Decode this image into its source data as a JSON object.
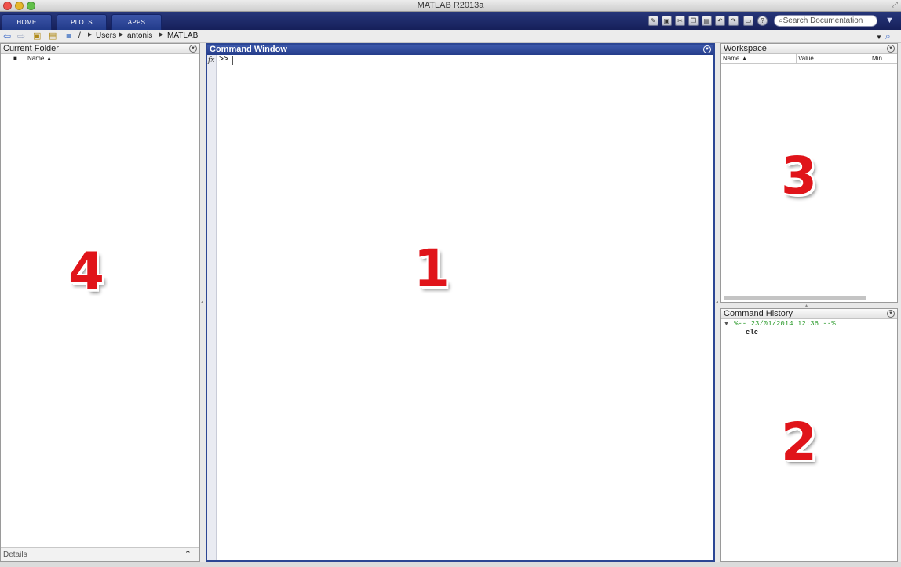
{
  "window": {
    "title": "MATLAB R2013a"
  },
  "tabs": [
    {
      "label": "HOME"
    },
    {
      "label": "PLOTS"
    },
    {
      "label": "APPS"
    }
  ],
  "toolbar": {
    "search_placeholder": "Search Documentation"
  },
  "address": {
    "root": "/",
    "crumbs": [
      "Users",
      "antonis",
      "MATLAB"
    ]
  },
  "current_folder": {
    "title": "Current Folder",
    "column_name": "Name ▲",
    "details_label": "Details",
    "annotation": "4"
  },
  "command_window": {
    "title": "Command Window",
    "prompt": ">>",
    "fx_label": "fx",
    "annotation": "1"
  },
  "workspace": {
    "title": "Workspace",
    "columns": [
      "Name ▲",
      "Value",
      "Min"
    ],
    "annotation": "3"
  },
  "command_history": {
    "title": "Command History",
    "session_header": "%-- 23/01/2014 12:36 --%",
    "entries": [
      "clc"
    ],
    "annotation": "2"
  },
  "colors": {
    "accent": "#253d8a",
    "history_green": "#2a9a2a",
    "annotation_red": "#e0141a"
  }
}
